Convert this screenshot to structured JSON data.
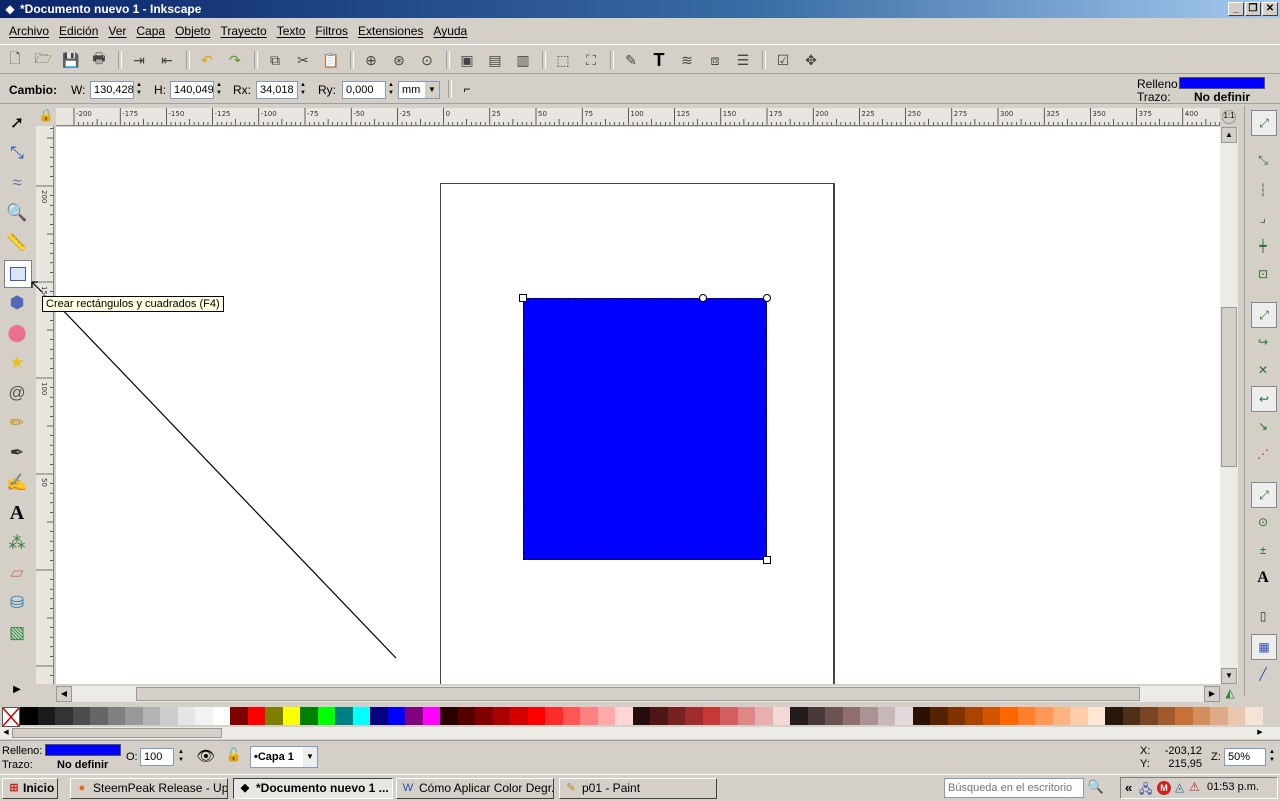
{
  "window": {
    "title": "*Documento nuevo 1 - Inkscape",
    "buttons": [
      "_",
      "❐",
      "✕"
    ]
  },
  "menu": [
    "Archivo",
    "Edición",
    "Ver",
    "Capa",
    "Objeto",
    "Trayecto",
    "Texto",
    "Filtros",
    "Extensiones",
    "Ayuda"
  ],
  "toolbar": {
    "icons": [
      "new-icon",
      "open-icon",
      "save-icon",
      "print-icon",
      "import-icon",
      "export-icon",
      "undo-icon",
      "redo-icon",
      "duplicate-icon",
      "cut-icon",
      "paste-icon",
      "zoom-selection-icon",
      "zoom-drawing-icon",
      "zoom-page-icon",
      "group-icon",
      "ungroup-icon",
      "clone-icon",
      "select-all-icon",
      "transform-icon",
      "fill-stroke-icon",
      "text-icon",
      "layers-icon",
      "xml-editor-icon",
      "align-icon",
      "preferences-icon",
      "document-properties-icon"
    ]
  },
  "controls": {
    "mode_label": "Cambio:",
    "w_label": "W:",
    "w_value": "130,428",
    "h_label": "H:",
    "h_value": "140,049",
    "rx_label": "Rx:",
    "rx_value": "34,018",
    "ry_label": "Ry:",
    "ry_value": "0,000",
    "unit": "mm",
    "fill_label": "Relleno:",
    "stroke_label": "Trazo:",
    "stroke_value": "No definir",
    "fill_color": "#0000ff"
  },
  "tooltip": "Crear rectángulos y cuadrados (F4)",
  "tools": [
    "selector-icon",
    "node-icon",
    "tweak-icon",
    "zoom-icon",
    "measure-icon",
    "rectangle-icon",
    "box-3d-icon",
    "ellipse-icon",
    "star-icon",
    "spiral-icon",
    "pencil-icon",
    "pen-icon",
    "calligraphy-icon",
    "text-tool-icon",
    "spray-icon",
    "eraser-icon",
    "paint-bucket-icon",
    "gradient-icon"
  ],
  "ruler_h": [
    "-200",
    "-175",
    "-150",
    "-125",
    "-100",
    "-75",
    "-50",
    "-25",
    "0",
    "25",
    "50",
    "75",
    "100",
    "125",
    "150",
    "175",
    "200",
    "225",
    "250",
    "275",
    "300",
    "325",
    "350",
    "375",
    "400"
  ],
  "ruler_v": [
    "200",
    "150",
    "100",
    "50"
  ],
  "palette": [
    "#000000",
    "#1a1a1a",
    "#333333",
    "#4d4d4d",
    "#666666",
    "#808080",
    "#999999",
    "#b3b3b3",
    "#cccccc",
    "#e6e6e6",
    "#f2f2f2",
    "#ffffff",
    "#800000",
    "#ff0000",
    "#808000",
    "#ffff00",
    "#008000",
    "#00ff00",
    "#008080",
    "#00ffff",
    "#000080",
    "#0000ff",
    "#800080",
    "#ff00ff",
    "#2b0000",
    "#550000",
    "#800000",
    "#aa0000",
    "#d40000",
    "#ff0000",
    "#ff2a2a",
    "#ff5555",
    "#ff8080",
    "#ffaaaa",
    "#ffd5d5",
    "#280b0b",
    "#501616",
    "#782121",
    "#a02c2c",
    "#c83737",
    "#d35f5f",
    "#de8787",
    "#e9afaf",
    "#f4d7d7",
    "#241c1c",
    "#483737",
    "#6c5353",
    "#916f6f",
    "#ac9393",
    "#c8b7b7",
    "#e3dbdb",
    "#2b1100",
    "#552200",
    "#803300",
    "#aa4400",
    "#d45500",
    "#ff6600",
    "#ff7f2a",
    "#ff9955",
    "#ffb380",
    "#ffccaa",
    "#ffe6d5",
    "#28170b",
    "#502d16",
    "#784421",
    "#a05a2c",
    "#c87137",
    "#d38d5f",
    "#deaa87",
    "#e9c6af",
    "#f4e3d7"
  ],
  "status": {
    "fill_label": "Relleno:",
    "stroke_label": "Trazo:",
    "stroke_value": "No definir",
    "opacity_label": "O:",
    "opacity_value": "100",
    "layer": "•Capa 1",
    "x_label": "X:",
    "x_value": "-203,12",
    "y_label": "Y:",
    "y_value": "215,95",
    "zoom_label": "Z:",
    "zoom_value": "50%"
  },
  "taskbar": {
    "start": "Inicio",
    "tasks": [
      "SteemPeak Release - Up...",
      "*Documento nuevo 1 ...",
      "Cómo Aplicar Color Degr...",
      "p01 - Paint"
    ],
    "search_placeholder": "Búsqueda en el escritorio",
    "clock": "01:53 p.m.",
    "tray_expand": "«"
  }
}
